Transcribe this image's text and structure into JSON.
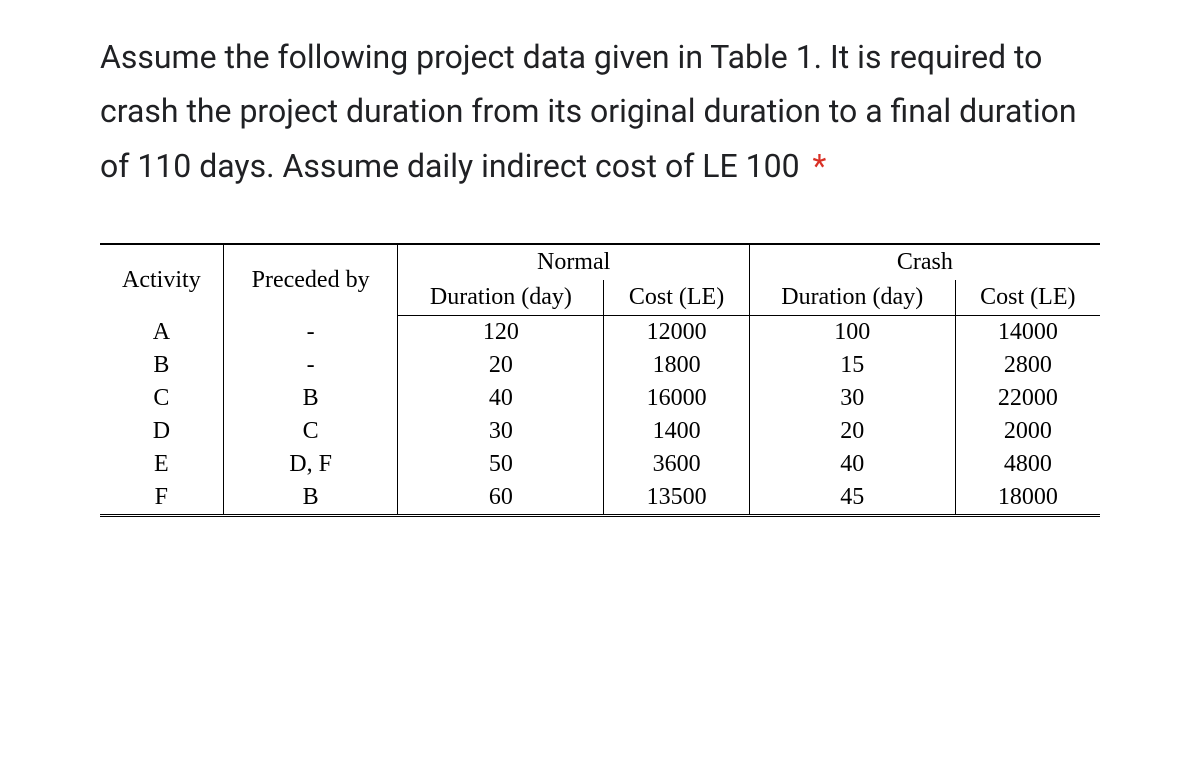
{
  "question": {
    "text": "Assume the following project data given in Table 1. It is required to crash the project duration from its original duration to a final duration of 110 days. Assume daily indirect cost of LE 100",
    "required_star": "*"
  },
  "table": {
    "headers": {
      "activity": "Activity",
      "preceded_by": "Preceded by",
      "normal_group": "Normal",
      "crash_group": "Crash",
      "duration": "Duration (day)",
      "cost": "Cost (LE)"
    },
    "rows": [
      {
        "activity": "A",
        "preceded_by": "-",
        "normal_duration": "120",
        "normal_cost": "12000",
        "crash_duration": "100",
        "crash_cost": "14000"
      },
      {
        "activity": "B",
        "preceded_by": "-",
        "normal_duration": "20",
        "normal_cost": "1800",
        "crash_duration": "15",
        "crash_cost": "2800"
      },
      {
        "activity": "C",
        "preceded_by": "B",
        "normal_duration": "40",
        "normal_cost": "16000",
        "crash_duration": "30",
        "crash_cost": "22000"
      },
      {
        "activity": "D",
        "preceded_by": "C",
        "normal_duration": "30",
        "normal_cost": "1400",
        "crash_duration": "20",
        "crash_cost": "2000"
      },
      {
        "activity": "E",
        "preceded_by": "D, F",
        "normal_duration": "50",
        "normal_cost": "3600",
        "crash_duration": "40",
        "crash_cost": "4800"
      },
      {
        "activity": "F",
        "preceded_by": "B",
        "normal_duration": "60",
        "normal_cost": "13500",
        "crash_duration": "45",
        "crash_cost": "18000"
      }
    ]
  }
}
